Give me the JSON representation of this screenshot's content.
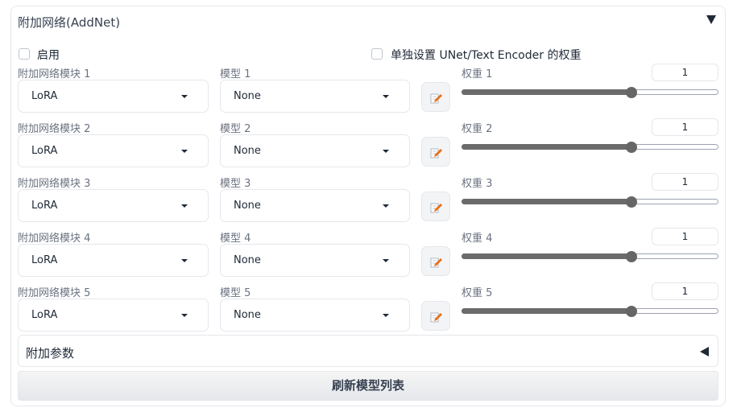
{
  "panel": {
    "title": "附加网络(AddNet)",
    "collapse_icon": "triangle-down-icon"
  },
  "options": {
    "enable_label": "启用",
    "enable_checked": false,
    "separate_weights_label": "单独设置 UNet/Text Encoder 的权重",
    "separate_weights_checked": false
  },
  "rows": [
    {
      "module_label": "附加网络模块 1",
      "module_value": "LoRA",
      "model_label": "模型 1",
      "model_value": "None",
      "weight_label": "权重 1",
      "weight_value": "1",
      "weight_fraction": 0.66
    },
    {
      "module_label": "附加网络模块 2",
      "module_value": "LoRA",
      "model_label": "模型 2",
      "model_value": "None",
      "weight_label": "权重 2",
      "weight_value": "1",
      "weight_fraction": 0.66
    },
    {
      "module_label": "附加网络模块 3",
      "module_value": "LoRA",
      "model_label": "模型 3",
      "model_value": "None",
      "weight_label": "权重 3",
      "weight_value": "1",
      "weight_fraction": 0.66
    },
    {
      "module_label": "附加网络模块 4",
      "module_value": "LoRA",
      "model_label": "模型 4",
      "model_value": "None",
      "weight_label": "权重 4",
      "weight_value": "1",
      "weight_fraction": 0.66
    },
    {
      "module_label": "附加网络模块 5",
      "module_value": "LoRA",
      "model_label": "模型 5",
      "model_value": "None",
      "weight_label": "权重 5",
      "weight_value": "1",
      "weight_fraction": 0.66
    }
  ],
  "extra_params": {
    "label": "附加参数",
    "icon": "triangle-left-icon"
  },
  "refresh_button": {
    "label": "刷新模型列表"
  },
  "icons": {
    "edit": "edit-pencil-icon"
  },
  "colors": {
    "slider_fill": "#6b6b6b",
    "edit_pencil": "#e8711a"
  }
}
